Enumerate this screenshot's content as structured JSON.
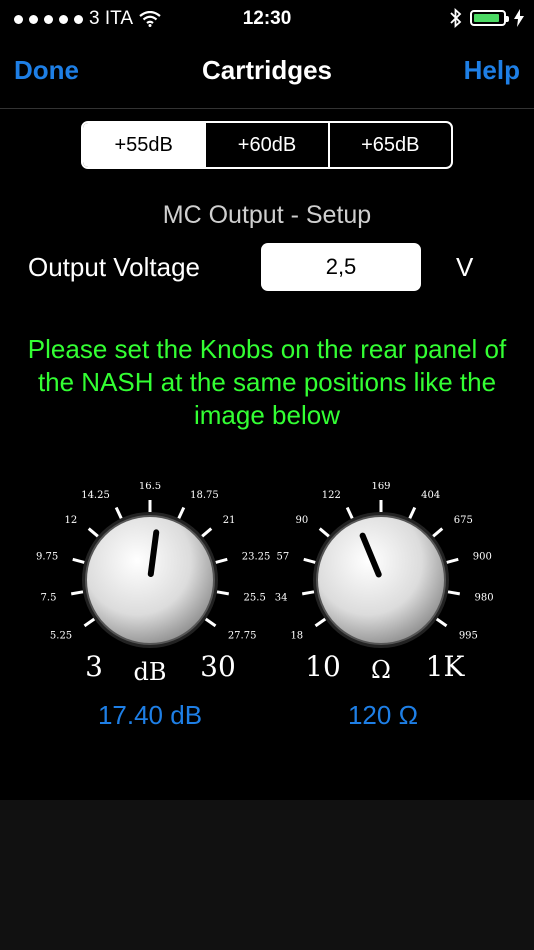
{
  "status": {
    "carrier": "3 ITA",
    "time": "12:30",
    "battery_level": 0.9,
    "signal_dots": 5
  },
  "nav": {
    "done": "Done",
    "title": "Cartridges",
    "help": "Help"
  },
  "gain_options": [
    "+55dB",
    "+60dB",
    "+65dB"
  ],
  "selected_gain": "+55dB",
  "mc_setup": {
    "title": "MC Output - Setup",
    "output_label": "Output Voltage",
    "output_value": "2,5",
    "output_unit": "V"
  },
  "instruction": "Please set the Knobs on the rear panel of the NASH at the same positions like the image below",
  "gain_knob": {
    "ticks": [
      "5.25",
      "7.5",
      "9.75",
      "12",
      "14.25",
      "16.5",
      "18.75",
      "21",
      "23.25",
      "25.5",
      "27.75"
    ],
    "min_label": "3",
    "unit_label": "dB",
    "max_label": "30",
    "pointer_fraction": 0.53,
    "readout": "17.40 dB"
  },
  "load_knob": {
    "ticks": [
      "18",
      "34",
      "57",
      "90",
      "122",
      "169",
      "404",
      "675",
      "900",
      "980",
      "995"
    ],
    "min_label": "10",
    "unit_label": "Ω",
    "max_label": "1K",
    "pointer_fraction": 0.41,
    "readout": "120 Ω"
  },
  "colors": {
    "accent": "#1e7fe6",
    "instruction": "#33ff33",
    "battery": "#4cd964"
  }
}
